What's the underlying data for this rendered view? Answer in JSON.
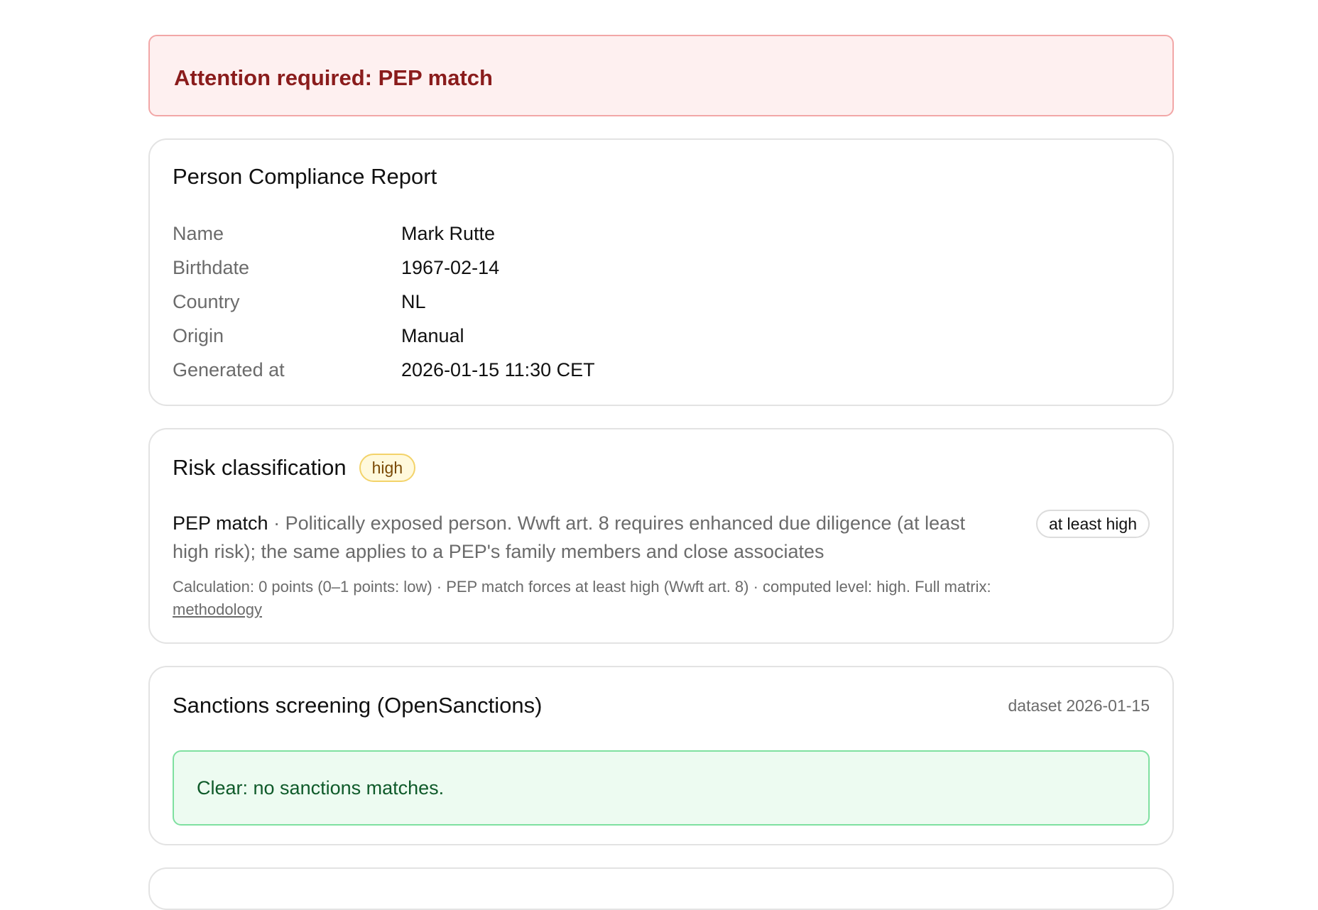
{
  "alert": {
    "title": "Attention required: PEP match"
  },
  "person": {
    "title": "Person Compliance Report",
    "fields": [
      {
        "key": "Name",
        "value": "Mark Rutte"
      },
      {
        "key": "Birthdate",
        "value": "1967-02-14"
      },
      {
        "key": "Country",
        "value": "NL"
      },
      {
        "key": "Origin",
        "value": "Manual"
      },
      {
        "key": "Generated at",
        "value": "2026-01-15 11:30 CET"
      }
    ]
  },
  "risk": {
    "title": "Risk classification",
    "level_badge": "high",
    "factor": {
      "name": "PEP match",
      "separator": " · ",
      "description": "Politically exposed person. Wwft art. 8 requires enhanced due diligence (at least high risk); the same applies to a PEP's family members and close associates",
      "pill": "at least high"
    },
    "calculation": "Calculation: 0 points (0–1 points: low) · PEP match forces at least high (Wwft art. 8) · computed level: high. Full matrix:",
    "methodology_link": "methodology"
  },
  "sanctions": {
    "title": "Sanctions screening (OpenSanctions)",
    "dataset": "dataset 2026-01-15",
    "result": "Clear: no sanctions matches."
  },
  "colors": {
    "alert_bg": "#fef0f0",
    "alert_border": "#f2a7a7",
    "alert_text": "#8a1c1c",
    "badge_high_bg": "#fff9dc",
    "badge_high_border": "#f3d36a",
    "clear_bg": "#edfbf1",
    "clear_border": "#7fe0a0",
    "clear_text": "#0f5a2a"
  }
}
